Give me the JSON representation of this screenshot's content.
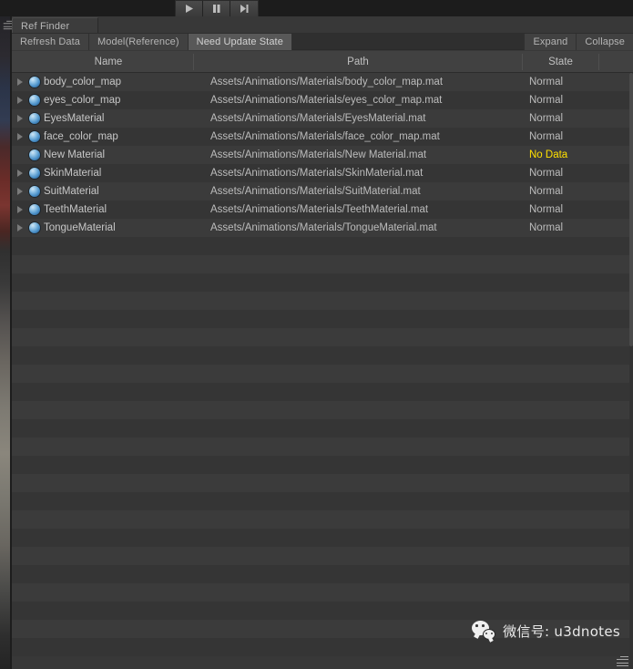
{
  "window": {
    "tab_title": "Ref Finder"
  },
  "playbar": {
    "play_icon": "play-icon",
    "pause_icon": "pause-icon",
    "step_icon": "step-forward-icon"
  },
  "toolbar": {
    "left_buttons": [
      {
        "label": "Refresh Data",
        "active": false
      },
      {
        "label": "Model(Reference)",
        "active": false
      },
      {
        "label": "Need Update State",
        "active": true
      }
    ],
    "right_buttons": [
      {
        "label": "Expand"
      },
      {
        "label": "Collapse"
      }
    ],
    "menu_icon": "hamburger-menu-icon"
  },
  "columns": [
    {
      "label": "Name"
    },
    {
      "label": "Path"
    },
    {
      "label": "State"
    }
  ],
  "rows": [
    {
      "name": "body_color_map",
      "path": "Assets/Animations/Materials/body_color_map.mat",
      "state": "Normal",
      "expandable": true,
      "warn": false,
      "icon": "material-sphere-icon"
    },
    {
      "name": "eyes_color_map",
      "path": "Assets/Animations/Materials/eyes_color_map.mat",
      "state": "Normal",
      "expandable": true,
      "warn": false,
      "icon": "material-sphere-icon"
    },
    {
      "name": "EyesMaterial",
      "path": "Assets/Animations/Materials/EyesMaterial.mat",
      "state": "Normal",
      "expandable": true,
      "warn": false,
      "icon": "material-sphere-icon"
    },
    {
      "name": "face_color_map",
      "path": "Assets/Animations/Materials/face_color_map.mat",
      "state": "Normal",
      "expandable": true,
      "warn": false,
      "icon": "material-sphere-icon"
    },
    {
      "name": "New Material",
      "path": "Assets/Animations/Materials/New Material.mat",
      "state": "No Data",
      "expandable": false,
      "warn": true,
      "icon": "material-sphere-icon"
    },
    {
      "name": "SkinMaterial",
      "path": "Assets/Animations/Materials/SkinMaterial.mat",
      "state": "Normal",
      "expandable": true,
      "warn": false,
      "icon": "material-sphere-icon"
    },
    {
      "name": "SuitMaterial",
      "path": "Assets/Animations/Materials/SuitMaterial.mat",
      "state": "Normal",
      "expandable": true,
      "warn": false,
      "icon": "material-sphere-icon"
    },
    {
      "name": "TeethMaterial",
      "path": "Assets/Animations/Materials/TeethMaterial.mat",
      "state": "Normal",
      "expandable": true,
      "warn": false,
      "icon": "material-sphere-icon"
    },
    {
      "name": "TongueMaterial",
      "path": "Assets/Animations/Materials/TongueMaterial.mat",
      "state": "Normal",
      "expandable": true,
      "warn": false,
      "icon": "material-sphere-icon"
    }
  ],
  "empty_row_count": 23,
  "watermark": {
    "text": "微信号: u3dnotes",
    "icon": "wechat-icon"
  },
  "colors": {
    "panel_bg": "#383838",
    "row_odd": "#3b3b3b",
    "row_even": "#353535",
    "toolbar_bg": "#414141",
    "active_tab": "#585858",
    "warn_text": "#ffe000",
    "text": "#c6c6c6"
  },
  "footer": {
    "menu_icon": "hamburger-menu-icon"
  }
}
